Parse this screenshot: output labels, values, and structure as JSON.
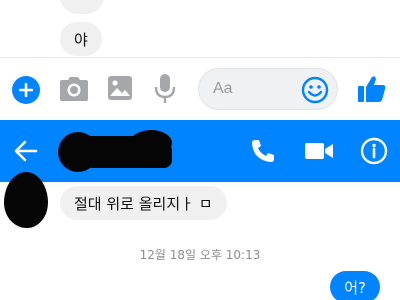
{
  "thread_top": {
    "message_partial": "야"
  },
  "composer": {
    "placeholder": "Aa",
    "icons": {
      "add": "plus-icon",
      "camera": "camera-icon",
      "gallery": "image-icon",
      "voice": "microphone-icon",
      "emoji": "smiley-icon",
      "like": "thumbs-up-icon"
    }
  },
  "header": {
    "icons": {
      "back": "arrow-left-icon",
      "call": "phone-icon",
      "video": "video-camera-icon",
      "info": "info-icon"
    }
  },
  "thread": {
    "incoming_message": "절대 위로 올리지ㅏ ㅁ",
    "timestamp": "12월 18일 오후 10:13",
    "outgoing_message": "어?"
  },
  "colors": {
    "accent": "#0084ff",
    "bubble_in": "#f1f0f0",
    "text_muted": "#8c8d91"
  }
}
